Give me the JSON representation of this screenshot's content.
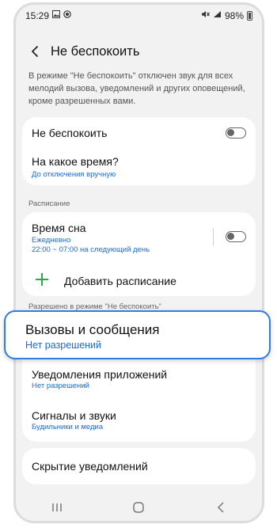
{
  "status_bar": {
    "time": "15:29",
    "battery": "98%",
    "left_icons": [
      "gallery-icon",
      "record-icon"
    ],
    "right_icons": [
      "mute-icon",
      "signal-icon"
    ]
  },
  "header": {
    "title": "Не беспокоить"
  },
  "description": "В режиме \"Не беспокоить\" отключен звук для всех мелодий вызова, уведомлений и других оповещений, кроме разрешенных вами.",
  "main_card": {
    "dnd_label": "Не беспокоить",
    "dnd_enabled": false,
    "duration_title": "На какое время?",
    "duration_value": "До отключения вручную"
  },
  "schedule": {
    "section_label": "Расписание",
    "sleep_title": "Время сна",
    "sleep_days": "Ежедневно",
    "sleep_time": "22:00 ~ 07:00 на следующий день",
    "sleep_enabled": false,
    "add_label": "Добавить расписание"
  },
  "allowed": {
    "section_label": "Разрешено в режиме \"Не беспокоить\"",
    "calls_title": "Вызовы и сообщения",
    "calls_value": "Нет разрешений",
    "apps_title": "Уведомления приложений",
    "apps_value": "Нет разрешений",
    "alarms_title": "Сигналы и звуки",
    "alarms_value": "Будильники и медиа"
  },
  "hide": {
    "title": "Скрытие уведомлений"
  },
  "colors": {
    "accent": "#1a6bd6",
    "highlight_border": "#2f7de1",
    "add_plus": "#2aa84a"
  }
}
